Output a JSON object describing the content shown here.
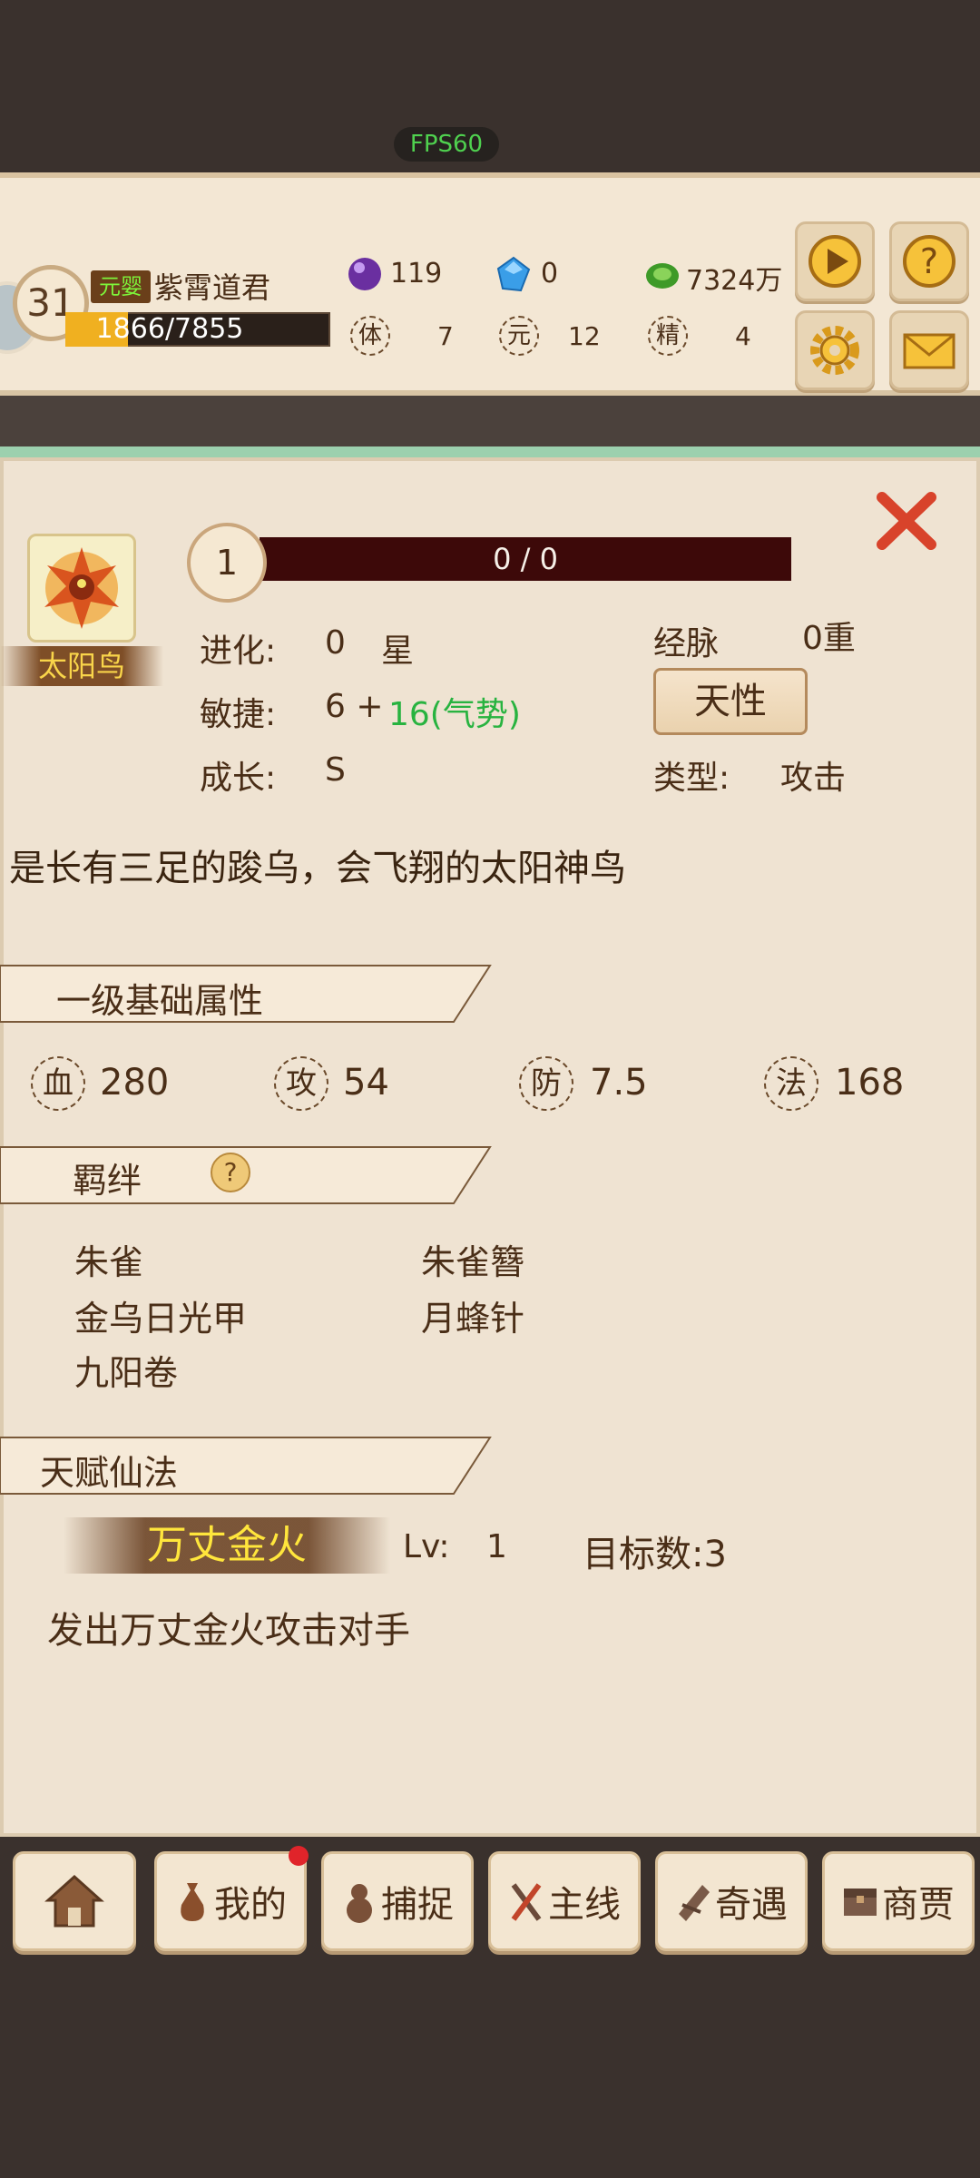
{
  "status": {
    "fps": "FPS60"
  },
  "player": {
    "level": "31",
    "realm": "元婴",
    "name": "紫霄道君",
    "exp_text": "1866/7855",
    "exp_fraction": 0.2375
  },
  "resources": {
    "gem_purple": "119",
    "gem_blue": "0",
    "coins": "7324万"
  },
  "player_attrs": [
    {
      "seal": "体",
      "value": "7"
    },
    {
      "seal": "元",
      "value": "12"
    },
    {
      "seal": "精",
      "value": "4"
    }
  ],
  "header_buttons": [
    "play-icon",
    "help-icon",
    "gear-icon",
    "mail-icon"
  ],
  "pet": {
    "name": "太阳鸟",
    "level": "1",
    "hp_text": "0 / 0",
    "evolution_label": "进化:",
    "evolution_value": "0",
    "evolution_unit": "星",
    "agility_label": "敏捷:",
    "agility_base": "6 +",
    "agility_bonus": "16(气势)",
    "growth_label": "成长:",
    "growth_value": "S",
    "meridian_label": "经脉",
    "meridian_value": "0重",
    "nature_button": "天性",
    "type_label": "类型:",
    "type_value": "攻击",
    "description": "是长有三足的踆乌，会飞翔的太阳神鸟"
  },
  "sections": {
    "basic": "一级基础属性",
    "bonds": "羁绊",
    "talent": "天赋仙法"
  },
  "basic_stats": [
    {
      "seal": "血",
      "value": "280"
    },
    {
      "seal": "攻",
      "value": "54"
    },
    {
      "seal": "防",
      "value": "7.5"
    },
    {
      "seal": "法",
      "value": "168"
    }
  ],
  "bonds": [
    "朱雀",
    "朱雀簪",
    "金乌日光甲",
    "月蜂针",
    "九阳卷"
  ],
  "bonds_help": "?",
  "skill": {
    "name": "万丈金火",
    "level_label": "Lv:",
    "level_value": "1",
    "targets": "目标数:3",
    "description": "发出万丈金火攻击对手"
  },
  "nav": {
    "home": "home-icon",
    "mine": "我的",
    "capture": "捕捉",
    "main": "主线",
    "adventure": "奇遇",
    "trade": "商贾"
  },
  "colors": {
    "agility_bonus": "#28b340",
    "skill_name": "#ffe63c",
    "realm_badge": "#7ef43a",
    "hp_bar": "#3d0909"
  }
}
